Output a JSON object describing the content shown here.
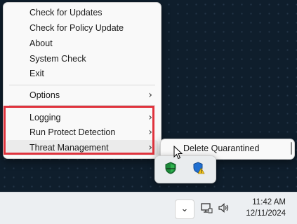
{
  "context_menu": {
    "items": [
      {
        "label": "Check for Updates"
      },
      {
        "label": "Check for Policy Update"
      },
      {
        "label": "About"
      },
      {
        "label": "System Check"
      },
      {
        "label": "Exit"
      },
      {
        "label": "Options",
        "chevron": "›"
      },
      {
        "label": "Logging",
        "chevron": "›"
      },
      {
        "label": "Run Protect Detection",
        "chevron": "›"
      },
      {
        "label": "Threat Management",
        "chevron": "›"
      }
    ]
  },
  "submenu": {
    "items": [
      {
        "label": "Delete Quarantined"
      }
    ]
  },
  "tray_overflow": {
    "icons": [
      "green-shield-icon",
      "blue-shield-warning-icon"
    ]
  },
  "taskbar": {
    "overflow_chevron": "⌄",
    "icons": [
      "network-icon",
      "volume-icon"
    ],
    "time": "11:42 AM",
    "date": "12/11/2024"
  },
  "colors": {
    "highlight_border": "#e0333d",
    "menu_background": "#f9f9f9",
    "hover_background": "#ebebeb",
    "desktop_background": "#0f1e2c"
  }
}
